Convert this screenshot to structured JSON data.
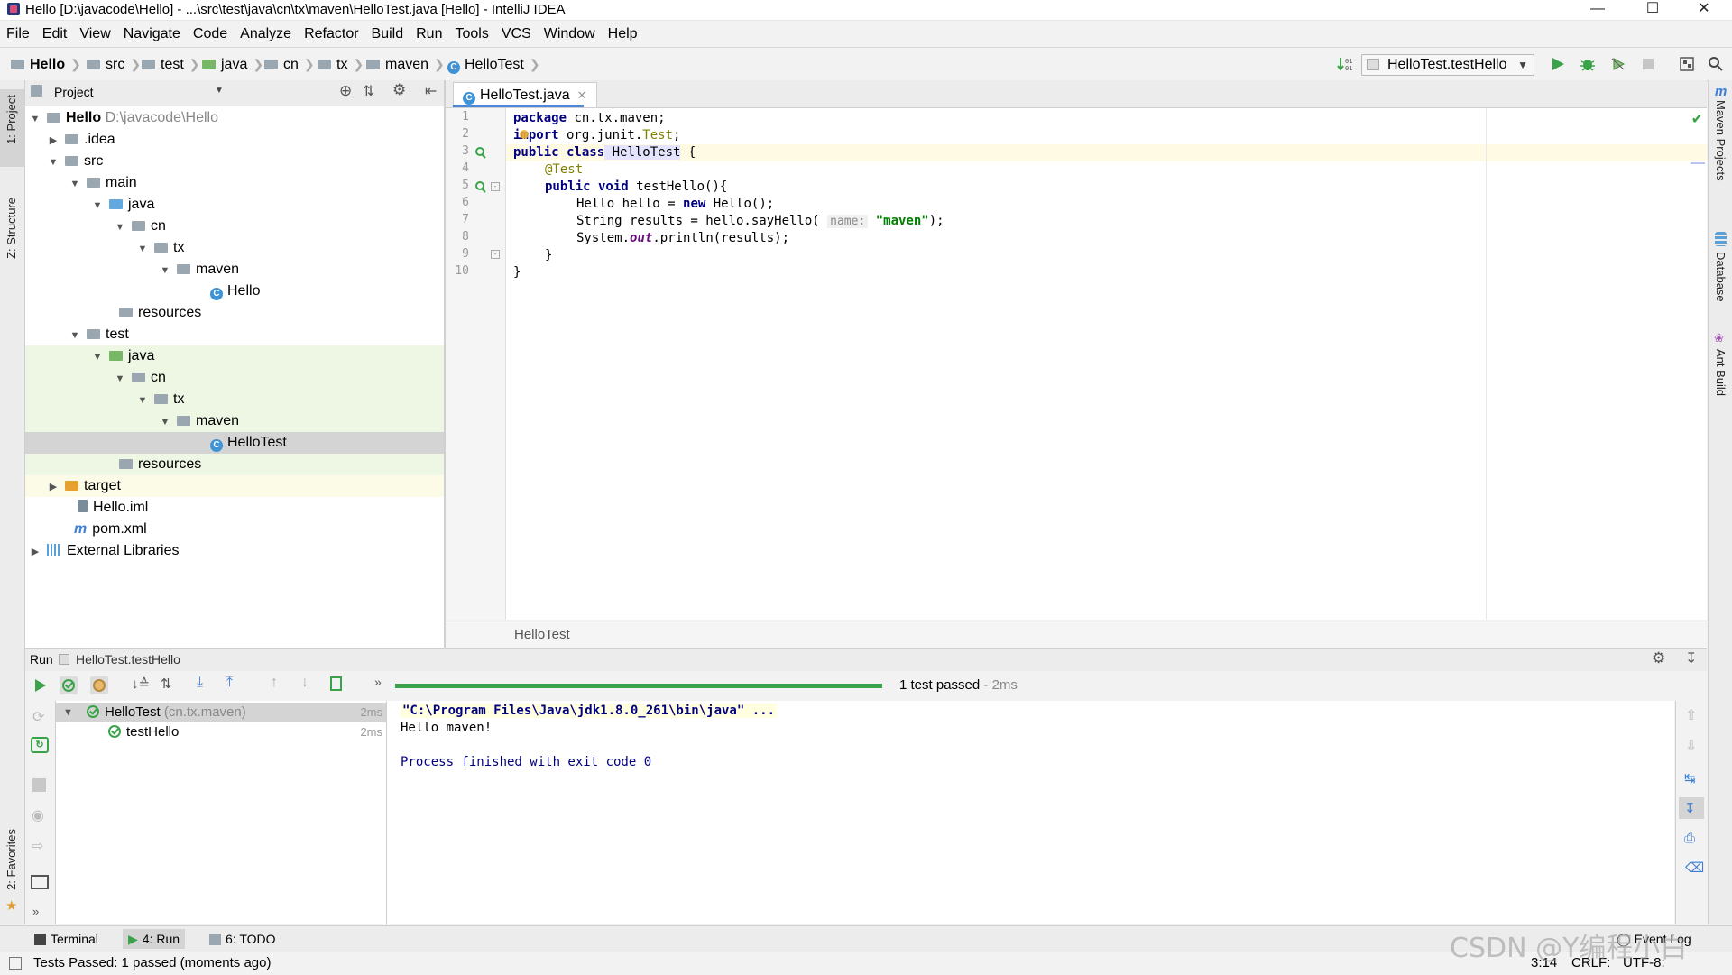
{
  "window": {
    "title": "Hello [D:\\javacode\\Hello] - ...\\src\\test\\java\\cn\\tx\\maven\\HelloTest.java [Hello] - IntelliJ IDEA"
  },
  "menu": [
    "File",
    "Edit",
    "View",
    "Navigate",
    "Code",
    "Analyze",
    "Refactor",
    "Build",
    "Run",
    "Tools",
    "VCS",
    "Window",
    "Help"
  ],
  "breadcrumbs": [
    "Hello",
    "src",
    "test",
    "java",
    "cn",
    "tx",
    "maven",
    "HelloTest"
  ],
  "run_config": "HelloTest.testHello",
  "left_tabs": {
    "project": "1: Project",
    "structure": "Z: Structure",
    "favorites": "2: Favorites"
  },
  "right_tabs": {
    "maven": "Maven Projects",
    "database": "Database",
    "ant": "Ant Build"
  },
  "project_panel": {
    "title": "Project",
    "root_name": "Hello",
    "root_path": "D:\\javacode\\Hello",
    "items": [
      ".idea",
      "src",
      "main",
      "java",
      "cn",
      "tx",
      "maven",
      "Hello",
      "resources",
      "test",
      "java",
      "cn",
      "tx",
      "maven",
      "HelloTest",
      "resources",
      "target",
      "Hello.iml",
      "pom.xml",
      "External Libraries"
    ]
  },
  "editor": {
    "tab": "HelloTest.java",
    "line_numbers": [
      "1",
      "2",
      "3",
      "4",
      "5",
      "6",
      "7",
      "8",
      "9",
      "10"
    ],
    "code": {
      "l1_kw": "package",
      "l1_rest": " cn.tx.maven;",
      "l2_kw": "import",
      "l2_rest": " org.junit.",
      "l2_test": "Test",
      "l2_end": ";",
      "l3_kw1": "public",
      "l3_kw2": " class",
      "l3_name": " HelloTest",
      "l3_end": " {",
      "l4_ann": "@Test",
      "l5_kw1": "public",
      "l5_kw2": " void",
      "l5_rest": " testHello(){",
      "l6_a": "Hello hello = ",
      "l6_kw": "new",
      "l6_b": " Hello();",
      "l7_a": "String results = hello.sayHello( ",
      "l7_hint": "name:",
      "l7_str": " \"maven\"",
      "l7_end": ");",
      "l8_a": "System.",
      "l8_out": "out",
      "l8_b": ".println(results);",
      "l9": "}",
      "l10": "}"
    },
    "footer": "HelloTest"
  },
  "run_panel": {
    "header_label": "Run",
    "header_config": "HelloTest.testHello",
    "status": "1 test passed",
    "status_time": " - 2ms",
    "progress": 1.0,
    "tests": [
      {
        "name": "HelloTest",
        "detail": " (cn.tx.maven)",
        "time": "2ms"
      },
      {
        "name": "testHello",
        "detail": "",
        "time": "2ms"
      }
    ],
    "console": [
      "\"C:\\Program Files\\Java\\jdk1.8.0_261\\bin\\java\" ...",
      "Hello maven!",
      "",
      "Process finished with exit code 0"
    ]
  },
  "bottom_tabs": {
    "terminal": "Terminal",
    "run": "4: Run",
    "todo": "6: TODO",
    "event_log": "Event Log"
  },
  "status_bar": {
    "message": "Tests Passed: 1 passed (moments ago)",
    "position": "3:14",
    "line_sep": "CRLF:",
    "encoding": "UTF-8:"
  },
  "watermark": "CSDN @Y编程小白",
  "colors": {
    "pass_green": "#3aa34a",
    "accent_blue": "#4a87d8",
    "keyword": "#000080",
    "string": "#008000"
  }
}
